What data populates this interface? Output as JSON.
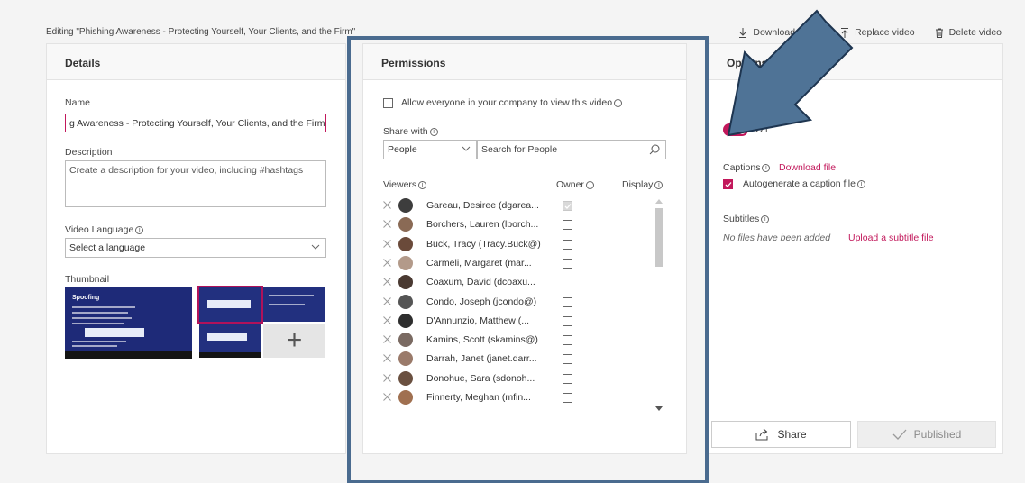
{
  "header": {
    "editing_title": "Editing \"Phishing Awareness - Protecting Yourself, Your Clients, and the Firm\"",
    "download_label": "Download video",
    "replace_label": "Replace video",
    "delete_label": "Delete video"
  },
  "details": {
    "heading": "Details",
    "name_label": "Name",
    "name_value": "g Awareness - Protecting Yourself, Your Clients, and the Firm",
    "description_label": "Description",
    "description_placeholder": "Create a description for your video, including #hashtags",
    "language_label": "Video Language",
    "language_value": "Select a language",
    "thumbnail_label": "Thumbnail",
    "thumb_slide_title": "Spoofing"
  },
  "permissions": {
    "heading": "Permissions",
    "allow_everyone_label": "Allow everyone in your company to view this video",
    "share_with_label": "Share with",
    "share_type": "People",
    "search_placeholder": "Search for People",
    "col_viewers": "Viewers",
    "col_owner": "Owner",
    "col_display": "Display",
    "viewers": [
      {
        "name": "Gareau, Desiree (dgarea...",
        "owner": true
      },
      {
        "name": "Borchers, Lauren (lborch...",
        "owner": false
      },
      {
        "name": "Buck, Tracy (Tracy.Buck@)",
        "owner": false
      },
      {
        "name": "Carmeli, Margaret (mar...",
        "owner": false
      },
      {
        "name": "Coaxum, David (dcoaxu...",
        "owner": false
      },
      {
        "name": "Condo, Joseph (jcondo@)",
        "owner": false
      },
      {
        "name": "D'Annunzio, Matthew (...",
        "owner": false
      },
      {
        "name": "Kamins, Scott (skamins@)",
        "owner": false
      },
      {
        "name": "Darrah, Janet (janet.darr...",
        "owner": false
      },
      {
        "name": "Donohue, Sara (sdonoh...",
        "owner": false
      },
      {
        "name": "Finnerty, Meghan (mfin...",
        "owner": false
      }
    ]
  },
  "options": {
    "heading": "Options",
    "toggle_state": "Off",
    "captions_label": "Captions",
    "download_file_link": "Download file",
    "autogenerate_label": "Autogenerate a caption file",
    "subtitles_label": "Subtitles",
    "no_files_text": "No files have been added",
    "upload_subtitle_link": "Upload a subtitle file",
    "share_button": "Share",
    "published_button": "Published"
  },
  "colors": {
    "accent": "#c2185b",
    "highlight_frame": "#4a6b8f",
    "arrow_fill": "#4f7396"
  },
  "avatar_colors": [
    "#3d3d3d",
    "#8a6a55",
    "#6a4a3a",
    "#b39a8a",
    "#4a3a32",
    "#555555",
    "#2e2e2e",
    "#7a6a62",
    "#9a7a6a",
    "#6a5040",
    "#a07050"
  ]
}
